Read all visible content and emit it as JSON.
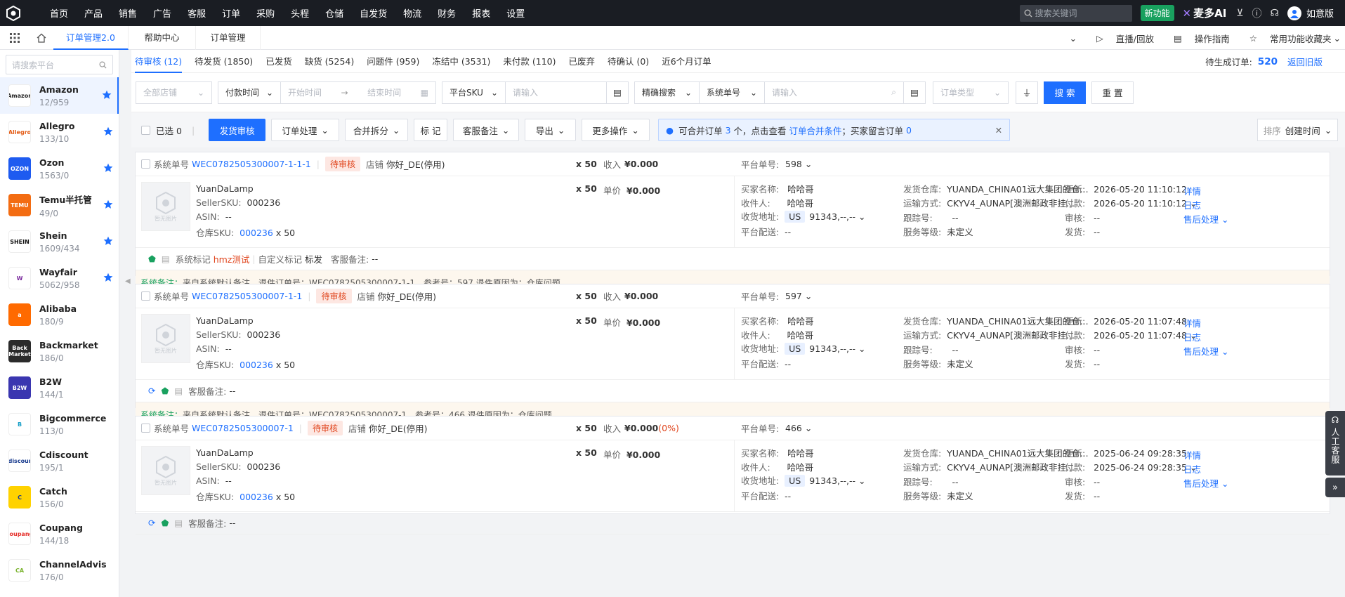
{
  "topnav": {
    "items": [
      "首页",
      "产品",
      "销售",
      "广告",
      "客服",
      "订单",
      "采购",
      "头程",
      "仓储",
      "自发货",
      "物流",
      "财务",
      "报表",
      "设置"
    ],
    "search_placeholder": "搜索关键词",
    "new_feature": "新功能",
    "brand": "麦多AI",
    "user": "如意版"
  },
  "tabbar": {
    "tabs": [
      "订单管理2.0",
      "帮助中心",
      "订单管理"
    ],
    "right": [
      "直播/回放",
      "操作指南",
      "常用功能收藏夹"
    ]
  },
  "sidebar": {
    "search_placeholder": "请搜索平台",
    "platforms": [
      {
        "name": "Amazon",
        "count": "12/959",
        "logo": "Amazon",
        "color": "#ffffff",
        "text": "#222",
        "starred": true
      },
      {
        "name": "Allegro",
        "count": "133/10",
        "logo": "Allegro",
        "color": "#ffffff",
        "text": "#e35b15",
        "starred": true
      },
      {
        "name": "Ozon",
        "count": "1563/0",
        "logo": "OZON",
        "color": "#1e5bf0",
        "text": "#fff",
        "starred": true
      },
      {
        "name": "Temu半托管",
        "count": "49/0",
        "logo": "TEMU",
        "color": "#f36c12",
        "text": "#fff",
        "starred": true
      },
      {
        "name": "Shein",
        "count": "1609/434",
        "logo": "SHEIN",
        "color": "#ffffff",
        "text": "#111",
        "starred": true
      },
      {
        "name": "Wayfair",
        "count": "5062/958",
        "logo": "W",
        "color": "#ffffff",
        "text": "#7b2c9e",
        "starred": true
      },
      {
        "name": "Alibaba",
        "count": "180/9",
        "logo": "a",
        "color": "#ff6a00",
        "text": "#fff",
        "starred": false
      },
      {
        "name": "Backmarket",
        "count": "186/0",
        "logo": "Back Market",
        "color": "#2b2b2b",
        "text": "#fff",
        "starred": false
      },
      {
        "name": "B2W",
        "count": "144/1",
        "logo": "B2W",
        "color": "#3a36b0",
        "text": "#fff",
        "starred": false
      },
      {
        "name": "Bigcommerce",
        "count": "113/0",
        "logo": "B",
        "color": "#ffffff",
        "text": "#1aa0c8",
        "starred": false
      },
      {
        "name": "Cdiscount",
        "count": "195/1",
        "logo": "Cdiscount",
        "color": "#ffffff",
        "text": "#1a3c8f",
        "starred": false
      },
      {
        "name": "Catch",
        "count": "156/0",
        "logo": "C",
        "color": "#ffd200",
        "text": "#1a3c8f",
        "starred": false
      },
      {
        "name": "Coupang",
        "count": "144/18",
        "logo": "coupang",
        "color": "#ffffff",
        "text": "#e5322d",
        "starred": false
      },
      {
        "name": "ChannelAdvis",
        "count": "176/0",
        "logo": "CA",
        "color": "#ffffff",
        "text": "#7ab32d",
        "starred": false
      }
    ]
  },
  "status_tabs": [
    "待审核 (12)",
    "待发货 (1850)",
    "已发货",
    "缺货 (5254)",
    "问题件 (959)",
    "冻结中 (3531)",
    "未付款 (110)",
    "已废弃",
    "待确认 (0)",
    "近6个月订单"
  ],
  "status_right": {
    "label": "待生成订单:",
    "value": "520",
    "link": "返回旧版"
  },
  "filters": {
    "store_ph": "全部店铺",
    "time_type": "付款时间",
    "start_ph": "开始时间",
    "end_ph": "结束时间",
    "sku_type": "平台SKU",
    "sku_ph": "请输入",
    "match": "精确搜索",
    "no_type": "系统单号",
    "no_ph": "请输入",
    "order_type_ph": "订单类型",
    "search": "搜 索",
    "reset": "重 置"
  },
  "actions": {
    "selected": "已选 0",
    "audit": "发货审核",
    "process": "订单处理",
    "merge": "合并拆分",
    "mark": "标 记",
    "cs_note": "客服备注",
    "export": "导出",
    "more": "更多操作",
    "notice_a": "可合并订单",
    "notice_n": "3",
    "notice_b": "个，点击查看",
    "notice_link": "订单合并条件",
    "notice_c": "；买家留言订单",
    "notice_m": "0",
    "sort_label": "排序",
    "sort_value": "创建时间"
  },
  "labels": {
    "sys_no": "系统单号",
    "store": "店铺",
    "income": "收入",
    "unit_price": "单价",
    "platform_no": "平台单号:",
    "seller_sku": "SellerSKU:",
    "asin": "ASIN:",
    "wh_sku": "仓库SKU:",
    "buyer": "买家名称:",
    "receiver": "收件人:",
    "address": "收货地址:",
    "plat_ship": "平台配送:",
    "warehouse": "发货仓库:",
    "ship_method": "运输方式:",
    "tracking": "跟踪号:",
    "service": "服务等级:",
    "updated": "更新:",
    "paid": "付款:",
    "audit": "审核:",
    "shipped": "发货:",
    "detail": "详情",
    "log": "日志",
    "aftersale": "售后处理",
    "no_image": "暂无图片",
    "status": "待审核",
    "sys_mark": "系统标记",
    "custom_mark": "自定义标记",
    "cs_note": "客服备注:",
    "sys_remark": "系统备注："
  },
  "orders": [
    {
      "no": "WEC0782505300007-1-1-1",
      "store": "你好_DE(停用)",
      "qty": "x 50",
      "income": "¥0.000",
      "income_pct": "",
      "plat_no": "598",
      "product": "YuanDaLamp",
      "sku": "000236",
      "asin": "--",
      "whsku": "000236",
      "whqty": "x 50",
      "price": "¥0.000",
      "buyer": "哈哈哥",
      "receiver": "哈哈哥",
      "country": "US",
      "addr": "91343,--,--",
      "plat_ship": "--",
      "warehouse": "YUANDA_CHINA01远大集团的仓...",
      "method": "CKYV4_AUNAP[澳洲邮政非挂...",
      "tracking": "--",
      "service": "未定义",
      "updated": "2026-05-20 11:10:12",
      "paid": "2026-05-20 11:10:12",
      "audit": "--",
      "shipped": "--",
      "mark_value": "hmz测试",
      "custom_value": "标发",
      "cs_value": "--",
      "remark": "来自系统默认备注，退件订单号：WEC0782505300007-1-1，参考号：597 退件原因为：仓库问题"
    },
    {
      "no": "WEC0782505300007-1-1",
      "store": "你好_DE(停用)",
      "qty": "x 50",
      "income": "¥0.000",
      "income_pct": "",
      "plat_no": "597",
      "product": "YuanDaLamp",
      "sku": "000236",
      "asin": "--",
      "whsku": "000236",
      "whqty": "x 50",
      "price": "¥0.000",
      "buyer": "哈哈哥",
      "receiver": "哈哈哥",
      "country": "US",
      "addr": "91343,--,--",
      "plat_ship": "--",
      "warehouse": "YUANDA_CHINA01远大集团的仓...",
      "method": "CKYV4_AUNAP[澳洲邮政非挂...",
      "tracking": "--",
      "service": "未定义",
      "updated": "2026-05-20 11:07:48",
      "paid": "2026-05-20 11:07:48",
      "audit": "--",
      "shipped": "--",
      "mark_value": "",
      "custom_value": "",
      "cs_value": "--",
      "remark": "来自系统默认备注，退件订单号：WEC0782505300007-1，参考号：466 退件原因为：仓库问题"
    },
    {
      "no": "WEC0782505300007-1",
      "store": "你好_DE(停用)",
      "qty": "x 50",
      "income": "¥0.000",
      "income_pct": "(0%)",
      "plat_no": "466",
      "product": "YuanDaLamp",
      "sku": "000236",
      "asin": "--",
      "whsku": "000236",
      "whqty": "x 50",
      "price": "¥0.000",
      "buyer": "哈哈哥",
      "receiver": "哈哈哥",
      "country": "US",
      "addr": "91343,--,--",
      "plat_ship": "--",
      "warehouse": "YUANDA_CHINA01远大集团的仓...",
      "method": "CKYV4_AUNAP[澳洲邮政非挂...",
      "tracking": "--",
      "service": "未定义",
      "updated": "2025-06-24 09:28:35",
      "paid": "2025-06-24 09:28:35",
      "audit": "--",
      "shipped": "--",
      "mark_value": "",
      "custom_value": "",
      "cs_value": "--",
      "remark": ""
    }
  ],
  "float_service": "人工客服",
  "colors": {
    "primary": "#1e6fff",
    "nav_bg": "#1a1d23",
    "pending_tag": "#e0451d",
    "remark_bg": "#fdf7ee",
    "green": "#19a15f"
  }
}
